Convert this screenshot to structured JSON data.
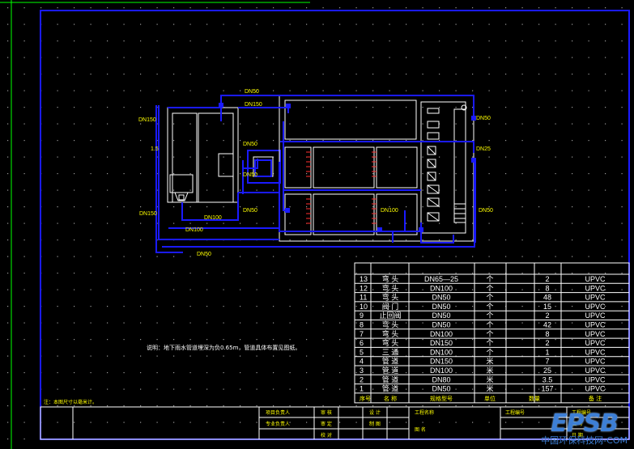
{
  "colors": {
    "background": "#000000",
    "frame": "#1a1aff",
    "border_green": "#00ff00",
    "label_yellow": "#ffff00",
    "line_white": "#ffffff",
    "accent_red": "#ff3030",
    "grid_dot": "#9a9a9a"
  },
  "pipe_labels": {
    "dn150_top": "DN150",
    "side_15": "1.5",
    "dn150_left": "DN150",
    "dn150_tank": "DN150",
    "dn50_top": "DN50",
    "dn50_a": "DN50",
    "dn50_b": "DN50",
    "dn50_c": "DN50",
    "dn100_mid": "DN100",
    "dn100_bottom": "DN100",
    "dn50_bottom": "DN50",
    "dn100_right": "DN100",
    "dn25_right": "DN25",
    "dn50_right_top": "DN50",
    "dn50_right_bottom": "DN50"
  },
  "note_main": "说明：地下雨水管道埋深为负0.65m，管道具体布置见图纸。",
  "note_bottom": "注：本图尺寸以毫米计。",
  "materials_table": {
    "columns": [
      "序号",
      "名 称",
      "规格型号",
      "单位",
      "数量",
      "备 注"
    ],
    "rows": [
      [
        "13",
        "弯 头",
        "DN65—25",
        "个",
        "2",
        "UPVC"
      ],
      [
        "12",
        "弯 头",
        "DN100",
        "个",
        "8",
        "UPVC"
      ],
      [
        "11",
        "弯 头",
        "DN50",
        "个",
        "48",
        "UPVC"
      ],
      [
        "10",
        "阀 门",
        "DN50",
        "个",
        "15",
        "UPVC"
      ],
      [
        "9",
        "止回阀",
        "DN50",
        "个",
        "2",
        "UPVC"
      ],
      [
        "8",
        "弯 头",
        "DN50",
        "个",
        "42",
        "UPVC"
      ],
      [
        "7",
        "弯 头",
        "DN100",
        "个",
        "8",
        "UPVC"
      ],
      [
        "6",
        "弯 头",
        "DN150",
        "个",
        "2",
        "UPVC"
      ],
      [
        "5",
        "三 通",
        "DN100",
        "个",
        "1",
        "UPVC"
      ],
      [
        "4",
        "管 道",
        "DN150",
        "米",
        "7",
        "UPVC"
      ],
      [
        "3",
        "管 道",
        "DN100",
        "米",
        "25",
        "UPVC"
      ],
      [
        "2",
        "管 道",
        "DN80",
        "米",
        "3.5",
        "UPVC"
      ],
      [
        "1",
        "管 道",
        "DN50",
        "米",
        "157",
        "UPVC"
      ]
    ]
  },
  "title_block": {
    "label_a": "项目负责人",
    "label_b": "专业负责人",
    "label_c": "审 核",
    "label_d": "审 定",
    "label_e": "校 对",
    "label_f": "设 计",
    "label_g": "制 图",
    "label_h": "工程名称",
    "drawing_name": "图 名",
    "label_i": "工程编号",
    "label_j": "图 号",
    "label_k": "日 期"
  },
  "watermark": {
    "logo": "EPSB",
    "site": "中国环保科技网-COM"
  }
}
